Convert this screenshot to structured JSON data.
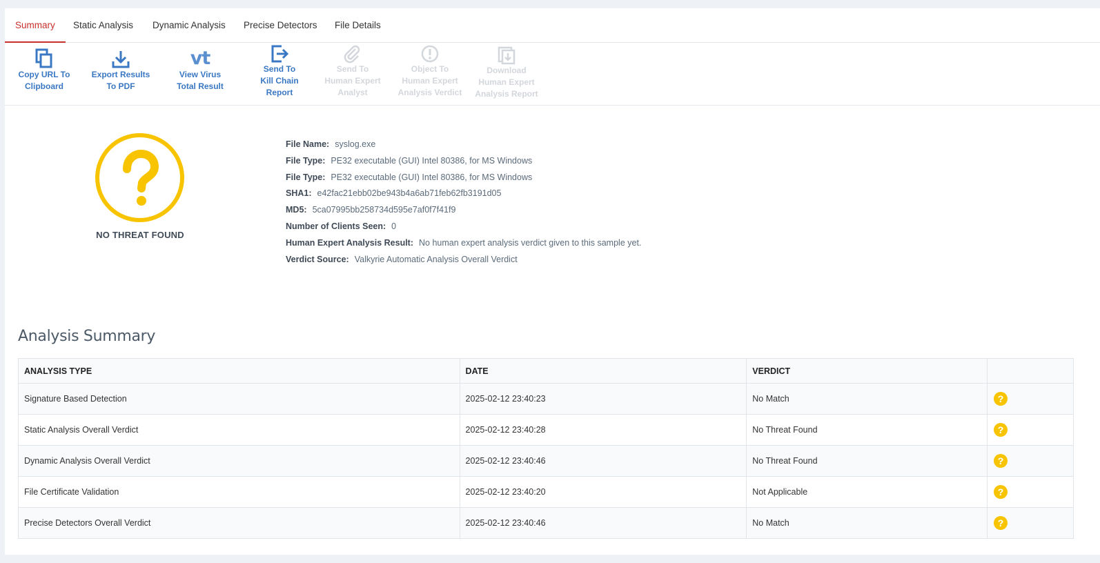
{
  "tabs": [
    {
      "label": "Summary",
      "active": true
    },
    {
      "label": "Static Analysis",
      "active": false
    },
    {
      "label": "Dynamic Analysis",
      "active": false
    },
    {
      "label": "Precise Detectors",
      "active": false
    },
    {
      "label": "File Details",
      "active": false
    }
  ],
  "toolbar": [
    {
      "label": "Copy URL To\nClipboard",
      "icon": "copy-icon",
      "enabled": true
    },
    {
      "label": "Export Results\nTo PDF",
      "icon": "download-icon",
      "enabled": true
    },
    {
      "label": "View Virus\nTotal Result",
      "icon": "virustotal-icon",
      "enabled": true
    },
    {
      "label": "Send To\nKill Chain\nReport",
      "icon": "send-arrow-icon",
      "enabled": true
    },
    {
      "label": "Send To\nHuman Expert\nAnalyst",
      "icon": "paperclip-icon",
      "enabled": false
    },
    {
      "label": "Object To\nHuman Expert\nAnalysis Verdict",
      "icon": "exclamation-icon",
      "enabled": false
    },
    {
      "label": "Download\nHuman Expert\nAnalysis Report",
      "icon": "download-report-icon",
      "enabled": false
    }
  ],
  "verdict": {
    "text": "NO THREAT FOUND",
    "symbol": "?",
    "color": "#f8c400"
  },
  "file_info": [
    {
      "key": "File Name:",
      "value": "syslog.exe"
    },
    {
      "key": "File Type:",
      "value": "PE32 executable (GUI) Intel 80386, for MS Windows"
    },
    {
      "key": "File Type:",
      "value": "PE32 executable (GUI) Intel 80386, for MS Windows"
    },
    {
      "key": "SHA1:",
      "value": "e42fac21ebb02be943b4a6ab71feb62fb3191d05"
    },
    {
      "key": "MD5:",
      "value": "5ca07995bb258734d595e7af0f7f41f9"
    },
    {
      "key": "Number of Clients Seen:",
      "value": "0"
    },
    {
      "key": "Human Expert Analysis Result:",
      "value": "No human expert analysis verdict given to this sample yet."
    },
    {
      "key": "Verdict Source:",
      "value": "Valkyrie Automatic Analysis Overall Verdict"
    }
  ],
  "analysis_summary": {
    "title": "Analysis Summary",
    "columns": [
      "ANALYSIS TYPE",
      "DATE",
      "VERDICT"
    ],
    "rows": [
      {
        "type": "Signature Based Detection",
        "date": "2025-02-12 23:40:23",
        "verdict": "No Match",
        "icon": "question-icon"
      },
      {
        "type": "Static Analysis Overall Verdict",
        "date": "2025-02-12 23:40:28",
        "verdict": "No Threat Found",
        "icon": "question-icon"
      },
      {
        "type": "Dynamic Analysis Overall Verdict",
        "date": "2025-02-12 23:40:46",
        "verdict": "No Threat Found",
        "icon": "question-icon"
      },
      {
        "type": "File Certificate Validation",
        "date": "2025-02-12 23:40:20",
        "verdict": "Not Applicable",
        "icon": "question-icon"
      },
      {
        "type": "Precise Detectors Overall Verdict",
        "date": "2025-02-12 23:40:46",
        "verdict": "No Match",
        "icon": "question-icon"
      }
    ]
  },
  "colors": {
    "accent_red": "#c9302c",
    "link_blue": "#3a78c3",
    "disabled_gray": "#d3d7dc",
    "warning_yellow": "#f8c400"
  }
}
